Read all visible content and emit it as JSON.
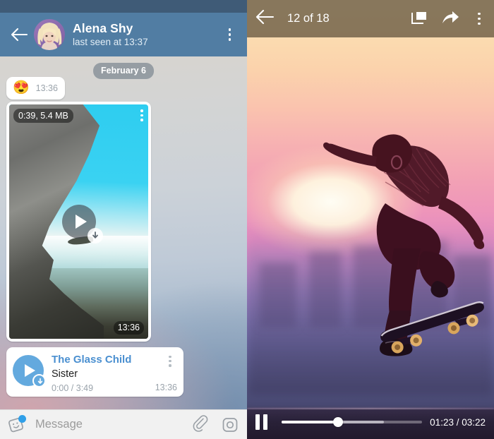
{
  "chat": {
    "header": {
      "back_icon": "back-arrow-icon",
      "avatar_alt": "alena-shy-avatar",
      "title": "Alena Shy",
      "subtitle": "last seen at 13:37",
      "menu_icon": "overflow-menu-icon",
      "bg_color": "#517da3",
      "status_bar_color": "#3f5b77"
    },
    "date_separator": "February 6",
    "messages": [
      {
        "type": "emoji",
        "emoji": "😍",
        "time": "13:36"
      },
      {
        "type": "video",
        "meta": "0:39, 5.4 MB",
        "time": "13:36",
        "play_icon": "play-icon",
        "download_icon": "download-icon",
        "menu_icon": "overflow-menu-icon"
      },
      {
        "type": "audio",
        "title": "The Glass Child",
        "artist": "Sister",
        "progress": "0:00 / 3:49",
        "time": "13:36",
        "play_icon": "play-icon",
        "download_icon": "download-icon",
        "menu_icon": "overflow-menu-icon",
        "accent_color": "#63a9de"
      }
    ],
    "input_bar": {
      "sticker_icon": "sticker-icon",
      "placeholder": "Message",
      "attach_icon": "paperclip-icon",
      "camera_icon": "camera-icon",
      "badge_color": "#2f9fe8"
    }
  },
  "player": {
    "topbar": {
      "back_icon": "back-arrow-icon",
      "title": "12 of 18",
      "pip_icon": "picture-in-picture-icon",
      "share_icon": "share-icon",
      "menu_icon": "overflow-menu-icon",
      "bg_color": "rgba(92,78,56,0.72)"
    },
    "controls": {
      "pause_icon": "pause-icon",
      "current_time": "01:23",
      "separator": "/",
      "total_time": "03:22",
      "time_label": "01:23 / 03:22",
      "progress_percent": 40,
      "buffered_percent": 73
    },
    "media_alt": "skateboarder-sunset-photo"
  }
}
